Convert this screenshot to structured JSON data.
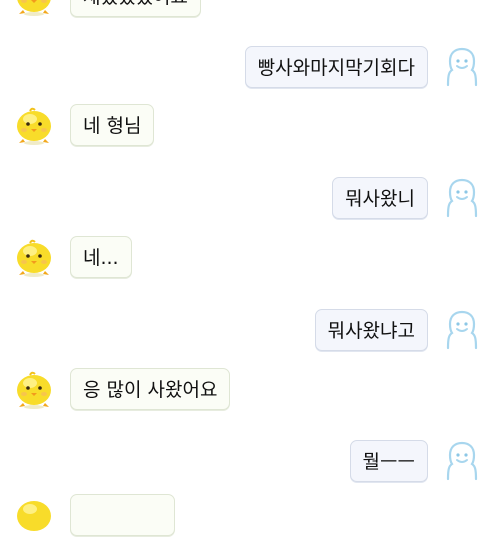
{
  "messages": [
    {
      "side": "in",
      "text": "재밌었었어요",
      "avatar": "simsimi-chick-icon"
    },
    {
      "side": "out",
      "text": "빵사와마지막기회다",
      "avatar": "ghost-outline-icon"
    },
    {
      "side": "in",
      "text": "네 형님",
      "avatar": "simsimi-chick-icon"
    },
    {
      "side": "out",
      "text": "뭐사왔니",
      "avatar": "ghost-outline-icon"
    },
    {
      "side": "in",
      "text": "네...",
      "avatar": "simsimi-chick-icon"
    },
    {
      "side": "out",
      "text": "뭐사왔냐고",
      "avatar": "ghost-outline-icon"
    },
    {
      "side": "in",
      "text": "응 많이 사왔어요",
      "avatar": "simsimi-chick-icon"
    },
    {
      "side": "out",
      "text": "뭘ㅡㅡ",
      "avatar": "ghost-outline-icon"
    },
    {
      "side": "in",
      "text": "",
      "avatar": "simsimi-chick-icon"
    }
  ],
  "colors": {
    "incoming_bubble": "#fbfdf6",
    "outgoing_bubble": "#f4f6fc",
    "chick_yellow": "#f8dc2a",
    "ghost_outline": "#a8d6ee"
  }
}
